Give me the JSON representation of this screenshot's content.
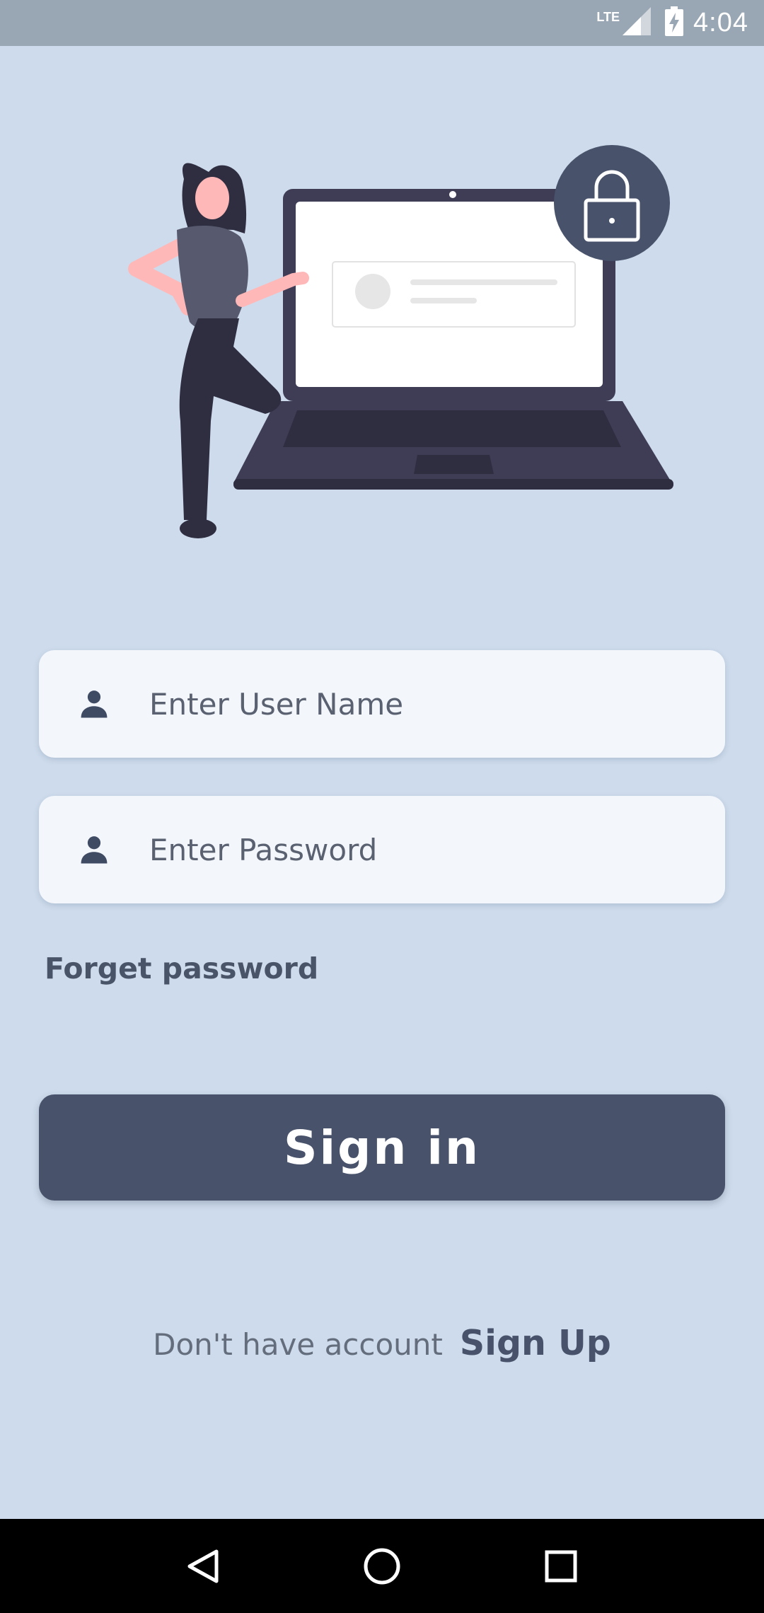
{
  "status_bar": {
    "network": "LTE",
    "time": "4:04"
  },
  "login": {
    "username_placeholder": "Enter User Name",
    "password_placeholder": "Enter Password",
    "forget_password": "Forget password",
    "sign_in": "Sign in",
    "no_account": "Don't have account",
    "sign_up": "Sign Up"
  },
  "icons": {
    "field_icon": "person-icon",
    "illustration_lock": "lock-icon"
  },
  "colors": {
    "background": "#cddbec",
    "status_bar": "#99a6b4",
    "field_bg": "#f3f7fc",
    "primary": "#48526a",
    "nav_bar": "#000000"
  }
}
